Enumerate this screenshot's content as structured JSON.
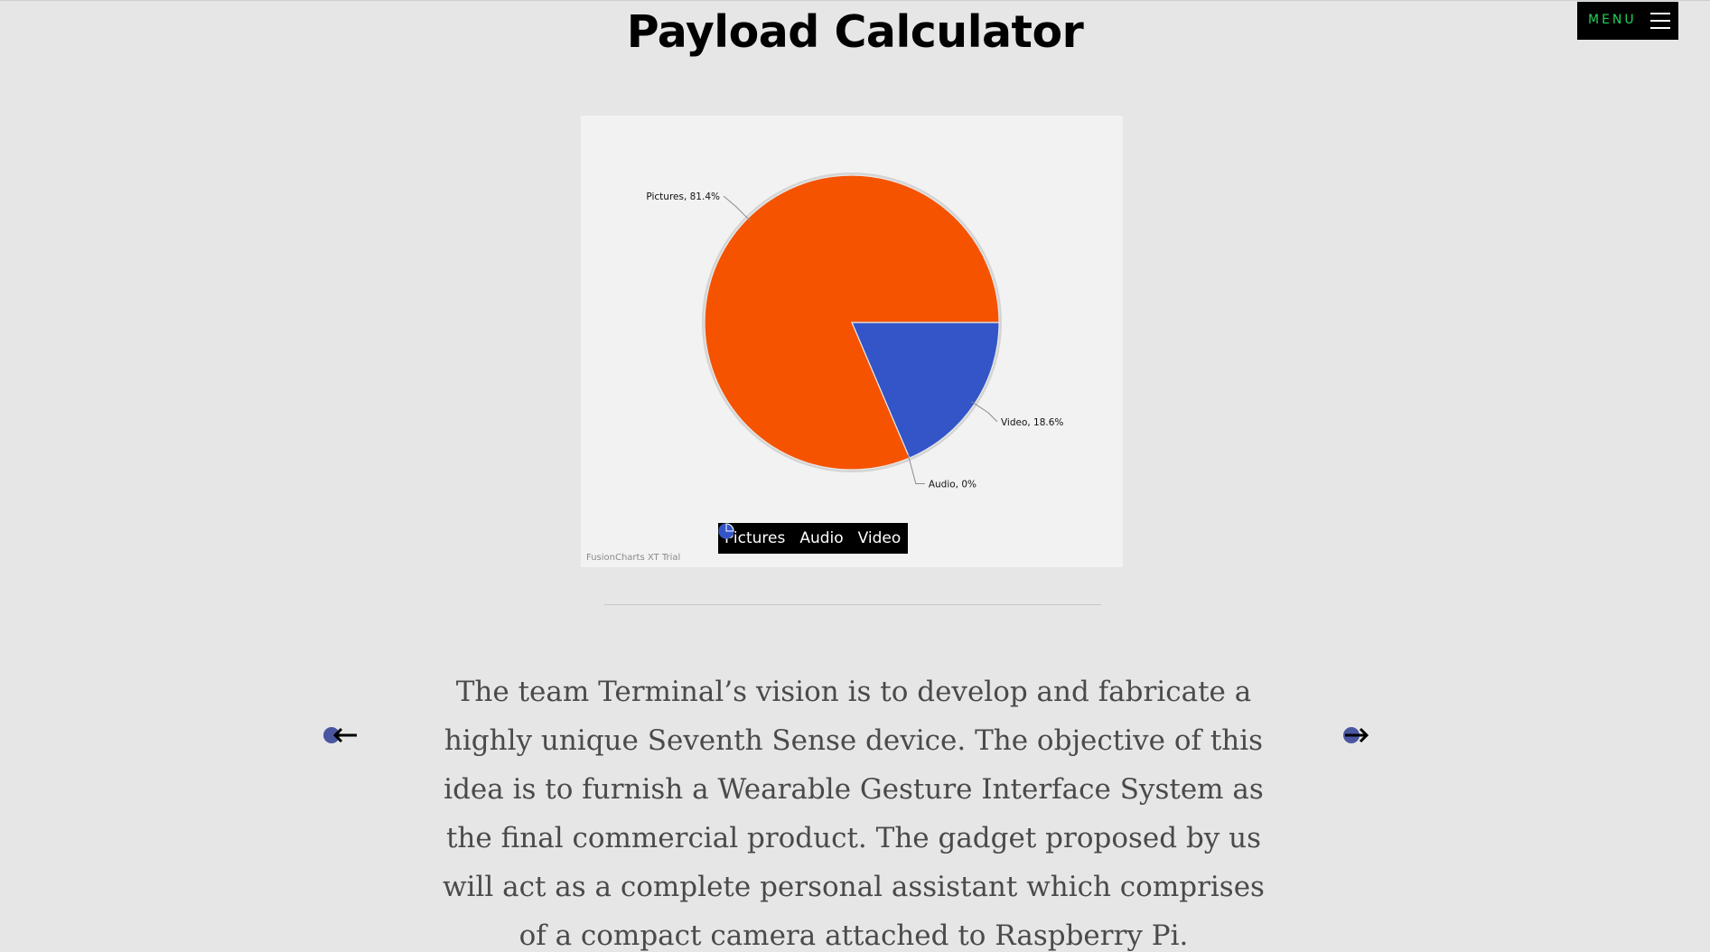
{
  "page": {
    "title": "Payload Calculator",
    "menu_label": "MENU",
    "menu_icon": "hamburger-icon",
    "description": "The team Terminal’s vision is to develop and fabricate a highly unique Seventh Sense device. The objective of this idea is to furnish a Wearable Gesture Interface System as the final commercial product. The gadget proposed by us will act as a complete personal assistant which comprises of a compact camera attached to Raspberry Pi.",
    "prev_icon": "arrow-left-icon",
    "next_icon": "arrow-right-icon"
  },
  "chart_data": {
    "type": "pie",
    "title": "",
    "slices": [
      {
        "name": "Pictures",
        "percent": 81.4,
        "label": "Pictures, 81.4%",
        "color": "#f55300"
      },
      {
        "name": "Audio",
        "percent": 0,
        "label": "Audio, 0%",
        "color": "#2ecc71"
      },
      {
        "name": "Video",
        "percent": 18.6,
        "label": "Video, 18.6%",
        "color": "#3355c8"
      }
    ],
    "legend": {
      "placement": "bottom",
      "items": [
        "Pictures",
        "Audio",
        "Video"
      ]
    },
    "watermark": "FusionCharts XT Trial"
  },
  "colors": {
    "accent_green": "#1fd05a",
    "background": "#e6e6e6",
    "chart_background": "#f2f2f2"
  }
}
